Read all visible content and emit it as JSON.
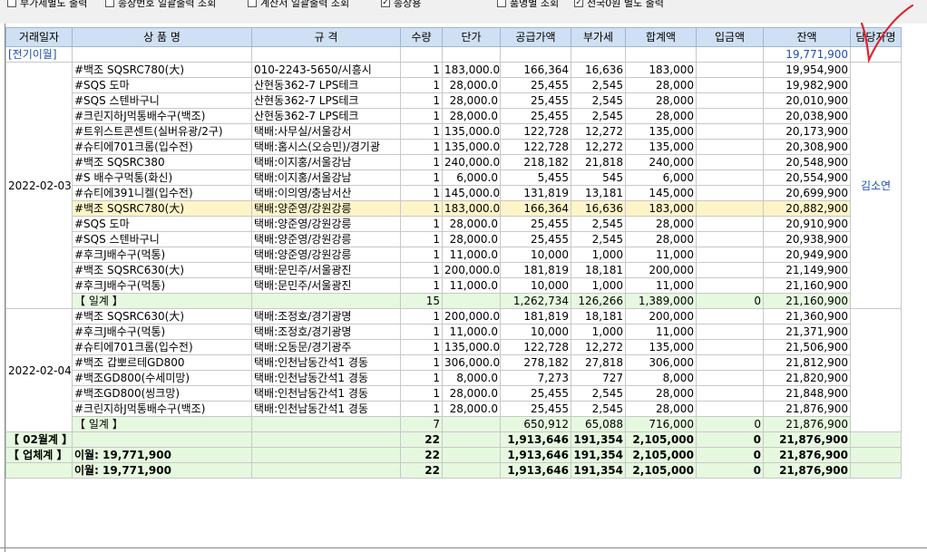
{
  "toolbar": {
    "options": [
      {
        "label": "부가세별도 출력",
        "checked": false
      },
      {
        "label": "송장번호 일괄출력 조회",
        "checked": false
      },
      {
        "label": "계산서 일괄출력 조회",
        "checked": false
      },
      {
        "label": "송장용",
        "checked": true
      },
      {
        "label": "품명별 조회",
        "checked": false
      },
      {
        "label": "전국0원 별도 출력",
        "checked": true
      }
    ]
  },
  "columns": [
    "거래일자",
    "상 품 명",
    "규 격",
    "수량",
    "단가",
    "공급가액",
    "부가세",
    "합계액",
    "입금액",
    "잔액",
    "담당자명"
  ],
  "carry": {
    "label": "[전기이월]",
    "balance": "19,771,900"
  },
  "groups": [
    {
      "date": "2022-02-03",
      "manager": "김소연",
      "rows": [
        {
          "product": "#백조 SQSRC780(大)",
          "spec": "010-2243-5650/시흥시",
          "qty": "1",
          "price": "183,000.0",
          "supply": "166,364",
          "vat": "16,636",
          "total": "183,000",
          "paid": "",
          "balance": "19,954,900"
        },
        {
          "product": "#SQS 도마",
          "spec": "산현동362-7 LPS테크",
          "qty": "1",
          "price": "28,000.0",
          "supply": "25,455",
          "vat": "2,545",
          "total": "28,000",
          "paid": "",
          "balance": "19,982,900"
        },
        {
          "product": "#SQS 스텐바구니",
          "spec": "산현동362-7 LPS테크",
          "qty": "1",
          "price": "28,000.0",
          "supply": "25,455",
          "vat": "2,545",
          "total": "28,000",
          "paid": "",
          "balance": "20,010,900"
        },
        {
          "product": "#크린지하J먹통배수구(백조)",
          "spec": "산현동362-7 LPS테크",
          "qty": "1",
          "price": "28,000.0",
          "supply": "25,455",
          "vat": "2,545",
          "total": "28,000",
          "paid": "",
          "balance": "20,038,900"
        },
        {
          "product": "#트위스트콘센트(실버유광/2구)",
          "spec": "택배:사무실/서울강서",
          "qty": "1",
          "price": "135,000.0",
          "supply": "122,728",
          "vat": "12,272",
          "total": "135,000",
          "paid": "",
          "balance": "20,173,900"
        },
        {
          "product": "#슈티에701크롬(입수전)",
          "spec": "택배:홈시스(오승민)/경기광",
          "qty": "1",
          "price": "135,000.0",
          "supply": "122,728",
          "vat": "12,272",
          "total": "135,000",
          "paid": "",
          "balance": "20,308,900"
        },
        {
          "product": "#백조 SQSRC380",
          "spec": "택배:이지홍/서울강남",
          "qty": "1",
          "price": "240,000.0",
          "supply": "218,182",
          "vat": "21,818",
          "total": "240,000",
          "paid": "",
          "balance": "20,548,900"
        },
        {
          "product": "#S 배수구먹통(화신)",
          "spec": "택배:이지홍/서울강남",
          "qty": "1",
          "price": "6,000.0",
          "supply": "5,455",
          "vat": "545",
          "total": "6,000",
          "paid": "",
          "balance": "20,554,900"
        },
        {
          "product": "#슈티에391니켈(입수전)",
          "spec": "택배:이의영/충남서산",
          "qty": "1",
          "price": "145,000.0",
          "supply": "131,819",
          "vat": "13,181",
          "total": "145,000",
          "paid": "",
          "balance": "20,699,900"
        },
        {
          "product": "#백조 SQSRC780(大)",
          "spec": "택배:양준영/강원강릉",
          "qty": "1",
          "price": "183,000.0",
          "supply": "166,364",
          "vat": "16,636",
          "total": "183,000",
          "paid": "",
          "balance": "20,882,900",
          "highlight": true
        },
        {
          "product": "#SQS 도마",
          "spec": "택배:양준영/강원강릉",
          "qty": "1",
          "price": "28,000.0",
          "supply": "25,455",
          "vat": "2,545",
          "total": "28,000",
          "paid": "",
          "balance": "20,910,900"
        },
        {
          "product": "#SQS 스텐바구니",
          "spec": "택배:양준영/강원강릉",
          "qty": "1",
          "price": "28,000.0",
          "supply": "25,455",
          "vat": "2,545",
          "total": "28,000",
          "paid": "",
          "balance": "20,938,900"
        },
        {
          "product": "#후크J배수구(먹통)",
          "spec": "택배:양준영/강원강릉",
          "qty": "1",
          "price": "11,000.0",
          "supply": "10,000",
          "vat": "1,000",
          "total": "11,000",
          "paid": "",
          "balance": "20,949,900"
        },
        {
          "product": "#백조 SQSRC630(大)",
          "spec": "택배:문민주/서울광진",
          "qty": "1",
          "price": "200,000.0",
          "supply": "181,819",
          "vat": "18,181",
          "total": "200,000",
          "paid": "",
          "balance": "21,149,900"
        },
        {
          "product": "#후크J배수구(먹통)",
          "spec": "택배:문민주/서울광진",
          "qty": "1",
          "price": "11,000.0",
          "supply": "10,000",
          "vat": "1,000",
          "total": "11,000",
          "paid": "",
          "balance": "21,160,900"
        }
      ],
      "subtotal": {
        "label": "【 일계 】",
        "qty": "15",
        "supply": "1,262,734",
        "vat": "126,266",
        "total": "1,389,000",
        "paid": "0",
        "balance": "21,160,900"
      }
    },
    {
      "date": "2022-02-04",
      "manager": "",
      "rows": [
        {
          "product": "#백조 SQSRC630(大)",
          "spec": "택배:조정호/경기광명",
          "qty": "1",
          "price": "200,000.0",
          "supply": "181,819",
          "vat": "18,181",
          "total": "200,000",
          "paid": "",
          "balance": "21,360,900"
        },
        {
          "product": "#후크J배수구(먹통)",
          "spec": "택배:조정호/경기광명",
          "qty": "1",
          "price": "11,000.0",
          "supply": "10,000",
          "vat": "1,000",
          "total": "11,000",
          "paid": "",
          "balance": "21,371,900"
        },
        {
          "product": "#슈티에701크롬(입수전)",
          "spec": "택배:오동문/경기광주",
          "qty": "1",
          "price": "135,000.0",
          "supply": "122,728",
          "vat": "12,272",
          "total": "135,000",
          "paid": "",
          "balance": "21,506,900"
        },
        {
          "product": "#백조 갑뽀르테GD800",
          "spec": "택배:인천남동간석1 경동",
          "qty": "1",
          "price": "306,000.0",
          "supply": "278,182",
          "vat": "27,818",
          "total": "306,000",
          "paid": "",
          "balance": "21,812,900"
        },
        {
          "product": "#백조GD800(수세미망)",
          "spec": "택배:인천남동간석1 경동",
          "qty": "1",
          "price": "8,000.0",
          "supply": "7,273",
          "vat": "727",
          "total": "8,000",
          "paid": "",
          "balance": "21,820,900"
        },
        {
          "product": "#백조GD800(씽크망)",
          "spec": "택배:인천남동간석1 경동",
          "qty": "1",
          "price": "28,000.0",
          "supply": "25,455",
          "vat": "2,545",
          "total": "28,000",
          "paid": "",
          "balance": "21,848,900"
        },
        {
          "product": "#크린지하J먹통배수구(백조)",
          "spec": "택배:인천남동간석1 경동",
          "qty": "1",
          "price": "28,000.0",
          "supply": "25,455",
          "vat": "2,545",
          "total": "28,000",
          "paid": "",
          "balance": "21,876,900"
        }
      ],
      "subtotal": {
        "label": "【 일계 】",
        "qty": "7",
        "supply": "650,912",
        "vat": "65,088",
        "total": "716,000",
        "paid": "0",
        "balance": "21,876,900"
      }
    }
  ],
  "totals": [
    {
      "label": "【 02월계 】",
      "product": "",
      "qty": "22",
      "supply": "1,913,646",
      "vat": "191,354",
      "total": "2,105,000",
      "paid": "0",
      "balance": "21,876,900"
    },
    {
      "label": "【 업체계 】",
      "product": "이월: 19,771,900",
      "qty": "22",
      "supply": "1,913,646",
      "vat": "191,354",
      "total": "2,105,000",
      "paid": "0",
      "balance": "21,876,900"
    },
    {
      "label": "",
      "product": "이월: 19,771,900",
      "qty": "22",
      "supply": "1,913,646",
      "vat": "191,354",
      "total": "2,105,000",
      "paid": "0",
      "balance": "21,876,900"
    }
  ],
  "colors": {
    "header_bg": "#cfe0f4",
    "subtotal_bg": "#e6f8df",
    "highlight_bg": "#fdf4c8",
    "link_blue": "#1d4fb0",
    "mark_red": "#e0242b"
  }
}
